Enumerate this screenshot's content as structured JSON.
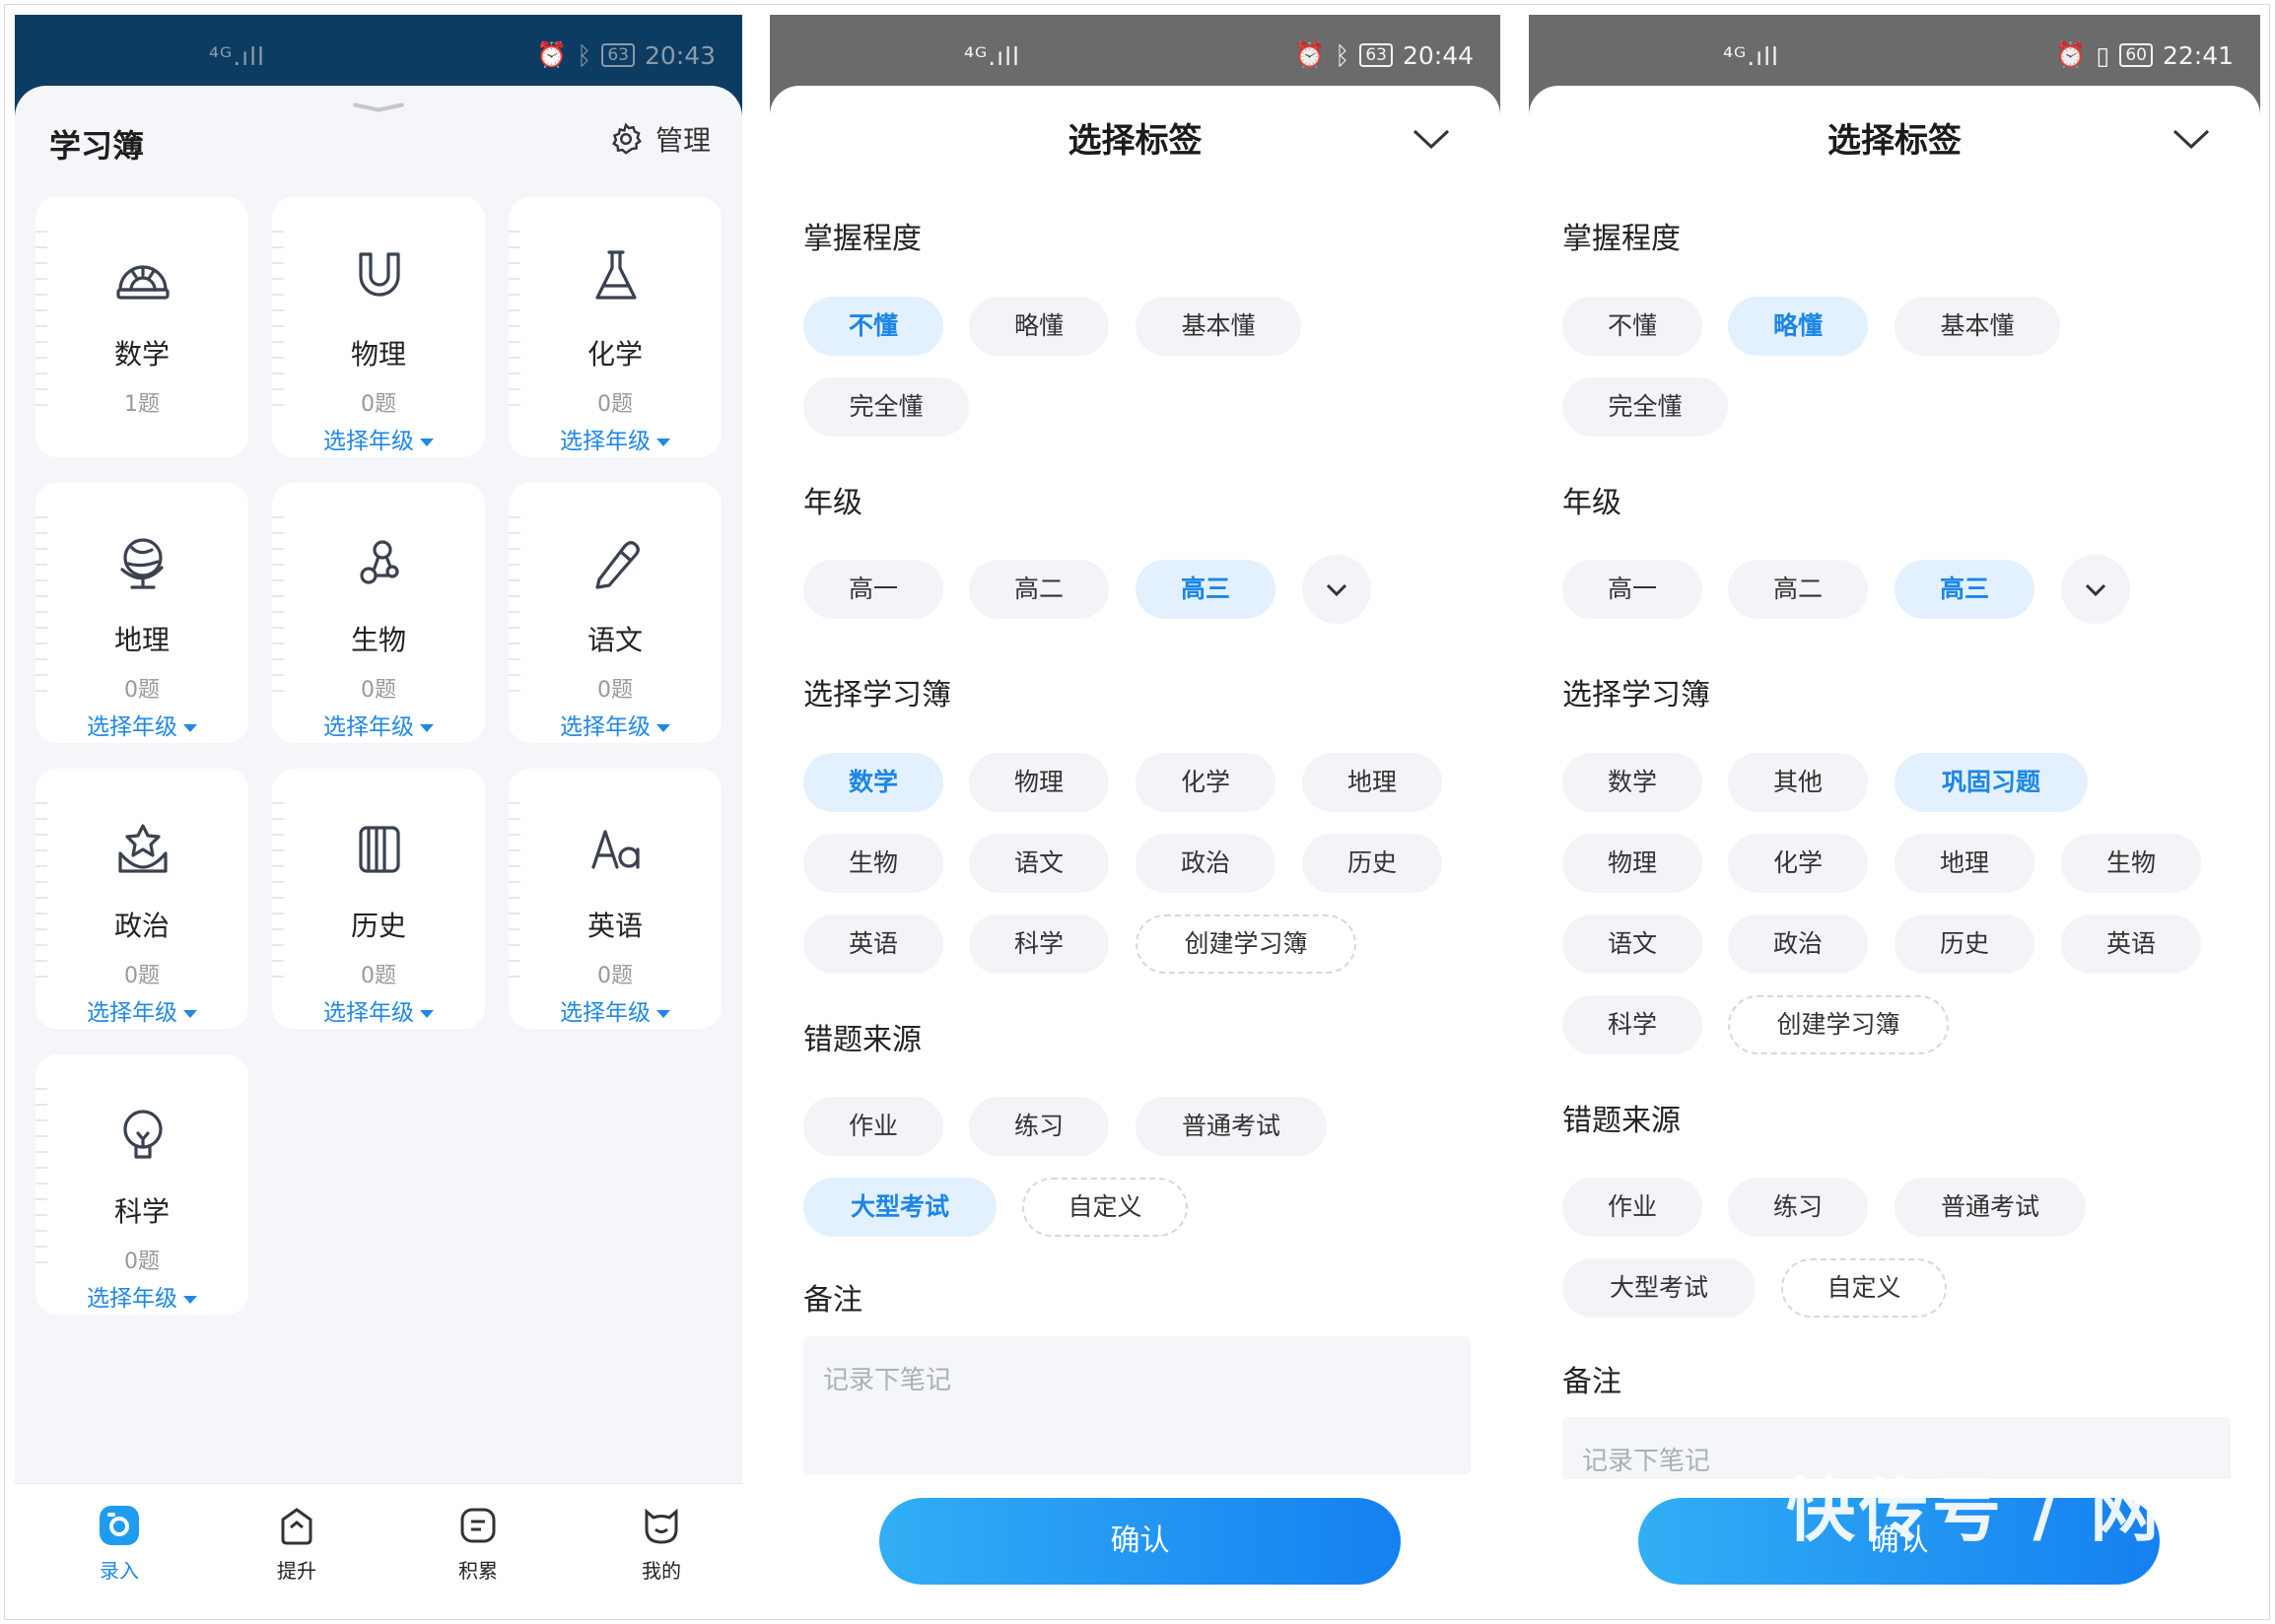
{
  "panel1": {
    "status": {
      "net": "⁴ᴳ.ıll",
      "time": "20:43",
      "battery": "63"
    },
    "title": "学习簿",
    "manage_label": "管理",
    "subjects": [
      {
        "name": "数学",
        "count": "1题",
        "grade": "",
        "icon": "protractor-icon"
      },
      {
        "name": "物理",
        "count": "0题",
        "grade": "选择年级",
        "icon": "magnet-icon"
      },
      {
        "name": "化学",
        "count": "0题",
        "grade": "选择年级",
        "icon": "flask-icon"
      },
      {
        "name": "地理",
        "count": "0题",
        "grade": "选择年级",
        "icon": "globe-icon"
      },
      {
        "name": "生物",
        "count": "0题",
        "grade": "选择年级",
        "icon": "molecule-icon"
      },
      {
        "name": "语文",
        "count": "0题",
        "grade": "选择年级",
        "icon": "pen-icon"
      },
      {
        "name": "政治",
        "count": "0题",
        "grade": "选择年级",
        "icon": "star-hand-icon"
      },
      {
        "name": "历史",
        "count": "0题",
        "grade": "选择年级",
        "icon": "scroll-icon"
      },
      {
        "name": "英语",
        "count": "0题",
        "grade": "选择年级",
        "icon": "letters-icon"
      },
      {
        "name": "科学",
        "count": "0题",
        "grade": "选择年级",
        "icon": "bulb-icon"
      }
    ],
    "tabs": [
      {
        "label": "录入",
        "icon": "camera-icon",
        "active": true
      },
      {
        "label": "提升",
        "icon": "arrow-up-icon",
        "active": false
      },
      {
        "label": "积累",
        "icon": "chat-icon",
        "active": false
      },
      {
        "label": "我的",
        "icon": "cat-icon",
        "active": false
      }
    ]
  },
  "panel2": {
    "status": {
      "time": "20:44",
      "battery": "63"
    },
    "title": "选择标签",
    "sections": {
      "mastery": "掌握程度",
      "grade": "年级",
      "book": "选择学习簿",
      "source": "错题来源",
      "note": "备注"
    },
    "mastery": [
      "不懂",
      "略懂",
      "基本懂",
      "完全懂"
    ],
    "grades": [
      "高一",
      "高二",
      "高三"
    ],
    "books": [
      "数学",
      "物理",
      "化学",
      "地理",
      "生物",
      "语文",
      "政治",
      "历史",
      "英语",
      "科学",
      "创建学习簿"
    ],
    "sources": [
      "作业",
      "练习",
      "普通考试",
      "大型考试",
      "自定义"
    ],
    "note_placeholder": "记录下笔记",
    "confirm": "确认"
  },
  "panel3": {
    "status": {
      "time": "22:41",
      "battery": "60"
    },
    "title": "选择标签",
    "sections": {
      "mastery": "掌握程度",
      "grade": "年级",
      "book": "选择学习簿",
      "source": "错题来源",
      "note": "备注"
    },
    "mastery": [
      "不懂",
      "略懂",
      "基本懂",
      "完全懂"
    ],
    "grades": [
      "高一",
      "高二",
      "高三"
    ],
    "books": [
      "数学",
      "其他",
      "巩固习题",
      "物理",
      "化学",
      "地理",
      "生物",
      "语文",
      "政治",
      "历史",
      "英语",
      "科学",
      "创建学习簿"
    ],
    "sources": [
      "作业",
      "练习",
      "普通考试",
      "大型考试",
      "自定义"
    ],
    "note_placeholder": "记录下笔记",
    "confirm": "确认",
    "watermark": "快传号 / 网"
  },
  "colors": {
    "accent": "#1f88e5",
    "selected_bg": "#e3f1fe",
    "chip_bg": "#f2f4f7",
    "header_dark": "#0d3c63"
  }
}
